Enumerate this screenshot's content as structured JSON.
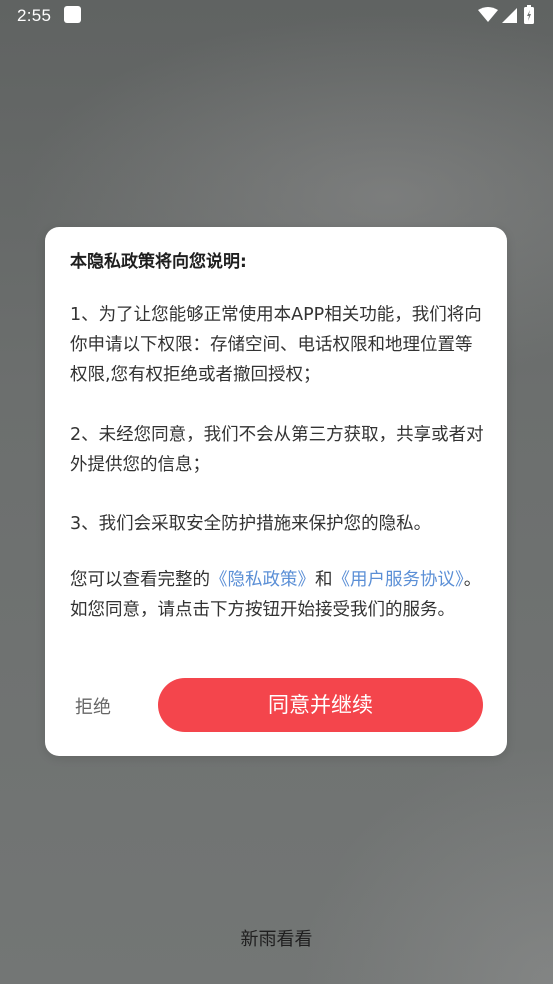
{
  "status_bar": {
    "time": "2:55",
    "icons": [
      "notification-icon",
      "wifi-icon",
      "cell-signal-icon",
      "battery-icon"
    ]
  },
  "dialog": {
    "title": "本隐私政策将向您说明:",
    "paragraph_1": "1、为了让您能够正常使用本APP相关功能，我们将向你申请以下权限：存储空间、电话权限和地理位置等权限,您有权拒绝或者撤回授权；",
    "paragraph_2": "2、未经您同意，我们不会从第三方获取，共享或者对外提供您的信息；",
    "paragraph_3": "3、我们会采取安全防护措施来保护您的隐私。",
    "paragraph_4": {
      "prefix": "您可以查看完整的",
      "privacy_link": "《隐私政策》",
      "and": "和",
      "terms_link": "《用户服务协议》",
      "suffix": "。如您同意，请点击下方按钮开始接受我们的服务。"
    },
    "reject_label": "拒绝",
    "agree_label": "同意并继续"
  },
  "footer": {
    "app_name": "新雨看看"
  },
  "colors": {
    "accent": "#f4454c",
    "link": "#5b8fd6",
    "overlay": "#6f7271"
  }
}
